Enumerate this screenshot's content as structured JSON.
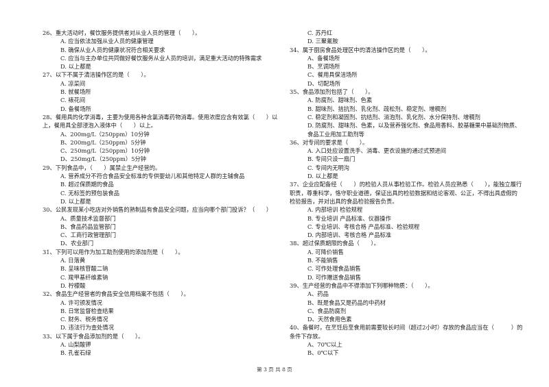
{
  "left_column": [
    {
      "stem": "26、重大活动时，餐饮服务提供者对从业人员的管理（　　）。",
      "options": [
        "A. 应当依法加强从业人员的健康管理",
        "B. 确保从业人员的健康状况符合相关要求",
        "C. 应当与主办单位共同做好餐饮服务从业人员的培训，满足重大活动的特殊需求",
        "D. 以上都是"
      ]
    },
    {
      "stem": "27、以下不属于清洁操作区的是（　　）。",
      "options": [
        "A. 凉菜间",
        "B. 就餐场所",
        "C. 裱花间",
        "D. 备餐场所"
      ]
    },
    {
      "stem": "28、餐用具的化学消毒，主要为使用各种含氯消毒药物消毒。使用浓度应含有效氯（　　）以上，餐用具全部浸泡入液体中（　　）以上。",
      "options": [
        "A、200mg/L（250ppm）10分钟",
        "B、200mg/L（250ppm）5分钟",
        "C、250mg/L（250ppm）10分钟",
        "D、250mg/L（250ppm）5分钟"
      ]
    },
    {
      "stem": "29、下列食品中，（　　）属禁止生产经营的。",
      "options": [
        "A. 营养成分不符合食品安全标准的专供婴幼儿和其他特定人群的主辅食品",
        "B. 超过保质期的食品",
        "C. 无标签的预包装食品",
        "D. 以上都是"
      ]
    },
    {
      "stem": "30、公民发现某小吃店对外销售的熟制品有食品安全问题，应当向哪个部门投诉？（　　）",
      "options": [
        "A、质量技术监督部门",
        "B、食品药品监管部门",
        "C、工商行政管理部门",
        "D、农业部门"
      ]
    },
    {
      "stem": "31、下列可以用作为加工助剂使用的添加剂是（　　）。",
      "options": [
        "A. 日落黄",
        "B. 呈味核苷酸二钠",
        "C. 羧甲基纤维素钠",
        "D. 柠檬酸"
      ]
    },
    {
      "stem": "32、食品生产经营者的食品安全信用档案不包括（　　）。",
      "options": [
        "A. 许可颁发情况",
        "B. 日常监督检查结果",
        "C. 财务、税务情况",
        "D. 违法行为查处情况"
      ]
    },
    {
      "stem": "33、以下属于食品添加剂的是（　　）。",
      "options": [
        "A. 山梨酸钾",
        "B. 孔雀石绿"
      ]
    }
  ],
  "right_column": [
    {
      "stem": "",
      "options": [
        "C. 苏丹红",
        "D. 三聚氰胺"
      ]
    },
    {
      "stem": "34、属于厨房食品处理区中的清洁操作区的是（　　）。",
      "options": [
        "A、备餐场所",
        "B、烹调场所",
        "C、餐用具保洁场所",
        "D、切配场所"
      ]
    },
    {
      "stem": "35、食品添加剂包括了（　　）。",
      "options": [
        "A. 防腐剂、甜味剂、色素",
        "B. 甜味剂、拮抗剂、乳化剂、疏松剂、稳定剂、增稠剂",
        "C. 稳定剂和凝固剂、抗结剂、消泡剂、乳化剂、水分保持剂、增稠剂",
        "D. 防腐剂、甜味剂、色素，以及营养强化剂、食品用香料、胶基糖果中基础剂物质、食品工业用加工助剂等"
      ]
    },
    {
      "stem": "36、对专间的要求是（　　）。",
      "options": [
        "A. 入口处应设置洗手、消毒、更衣设施的通过式预进间",
        "B. 专间只设一扇门",
        "C. 专间内无明沟",
        "D. 以上都是"
      ]
    },
    {
      "stem": "37、企业应配备经（　　）的检验人员从事检验工作。检验人员应熟悉（　　），能独立履行职责，尊重科学，恪守职业道德，保证出具的检验数据和结论客观、公正，不得出具虚假的检验报告，并对出具的食品检验报告负责。",
      "options": [
        "A. 内部培训 检验规程",
        "B. 专业培训 产品标准、仪器操作",
        "C. 专业培训、考核合格 产品标准、检验规程",
        "D. 内部培训、考核合格 产品标准"
      ]
    },
    {
      "stem": "38、超过保质期限的食品（　　）。",
      "options": [
        "A. 可降价销售",
        "B. 不能销售",
        "C. 可作处理食品销售",
        "D. 可作赠送食品销售"
      ]
    },
    {
      "stem": "39、生产经营的食品中不得添加下列哪种物质：（　　）。",
      "options": [
        "A、药品",
        "B、既是食品又是药品的中药材",
        "C、食品防腐剂",
        "D、天然食用色素"
      ]
    },
    {
      "stem": "40、备餐时，在烹饪后至食用前需要较长时间（超过2小时）存放的食品应当在（　　　）的条件下存放。",
      "options": [
        "A、70℃以上",
        "B、0℃以下"
      ]
    }
  ],
  "footer": {
    "page_label": "第 3 页 共 8 页"
  }
}
